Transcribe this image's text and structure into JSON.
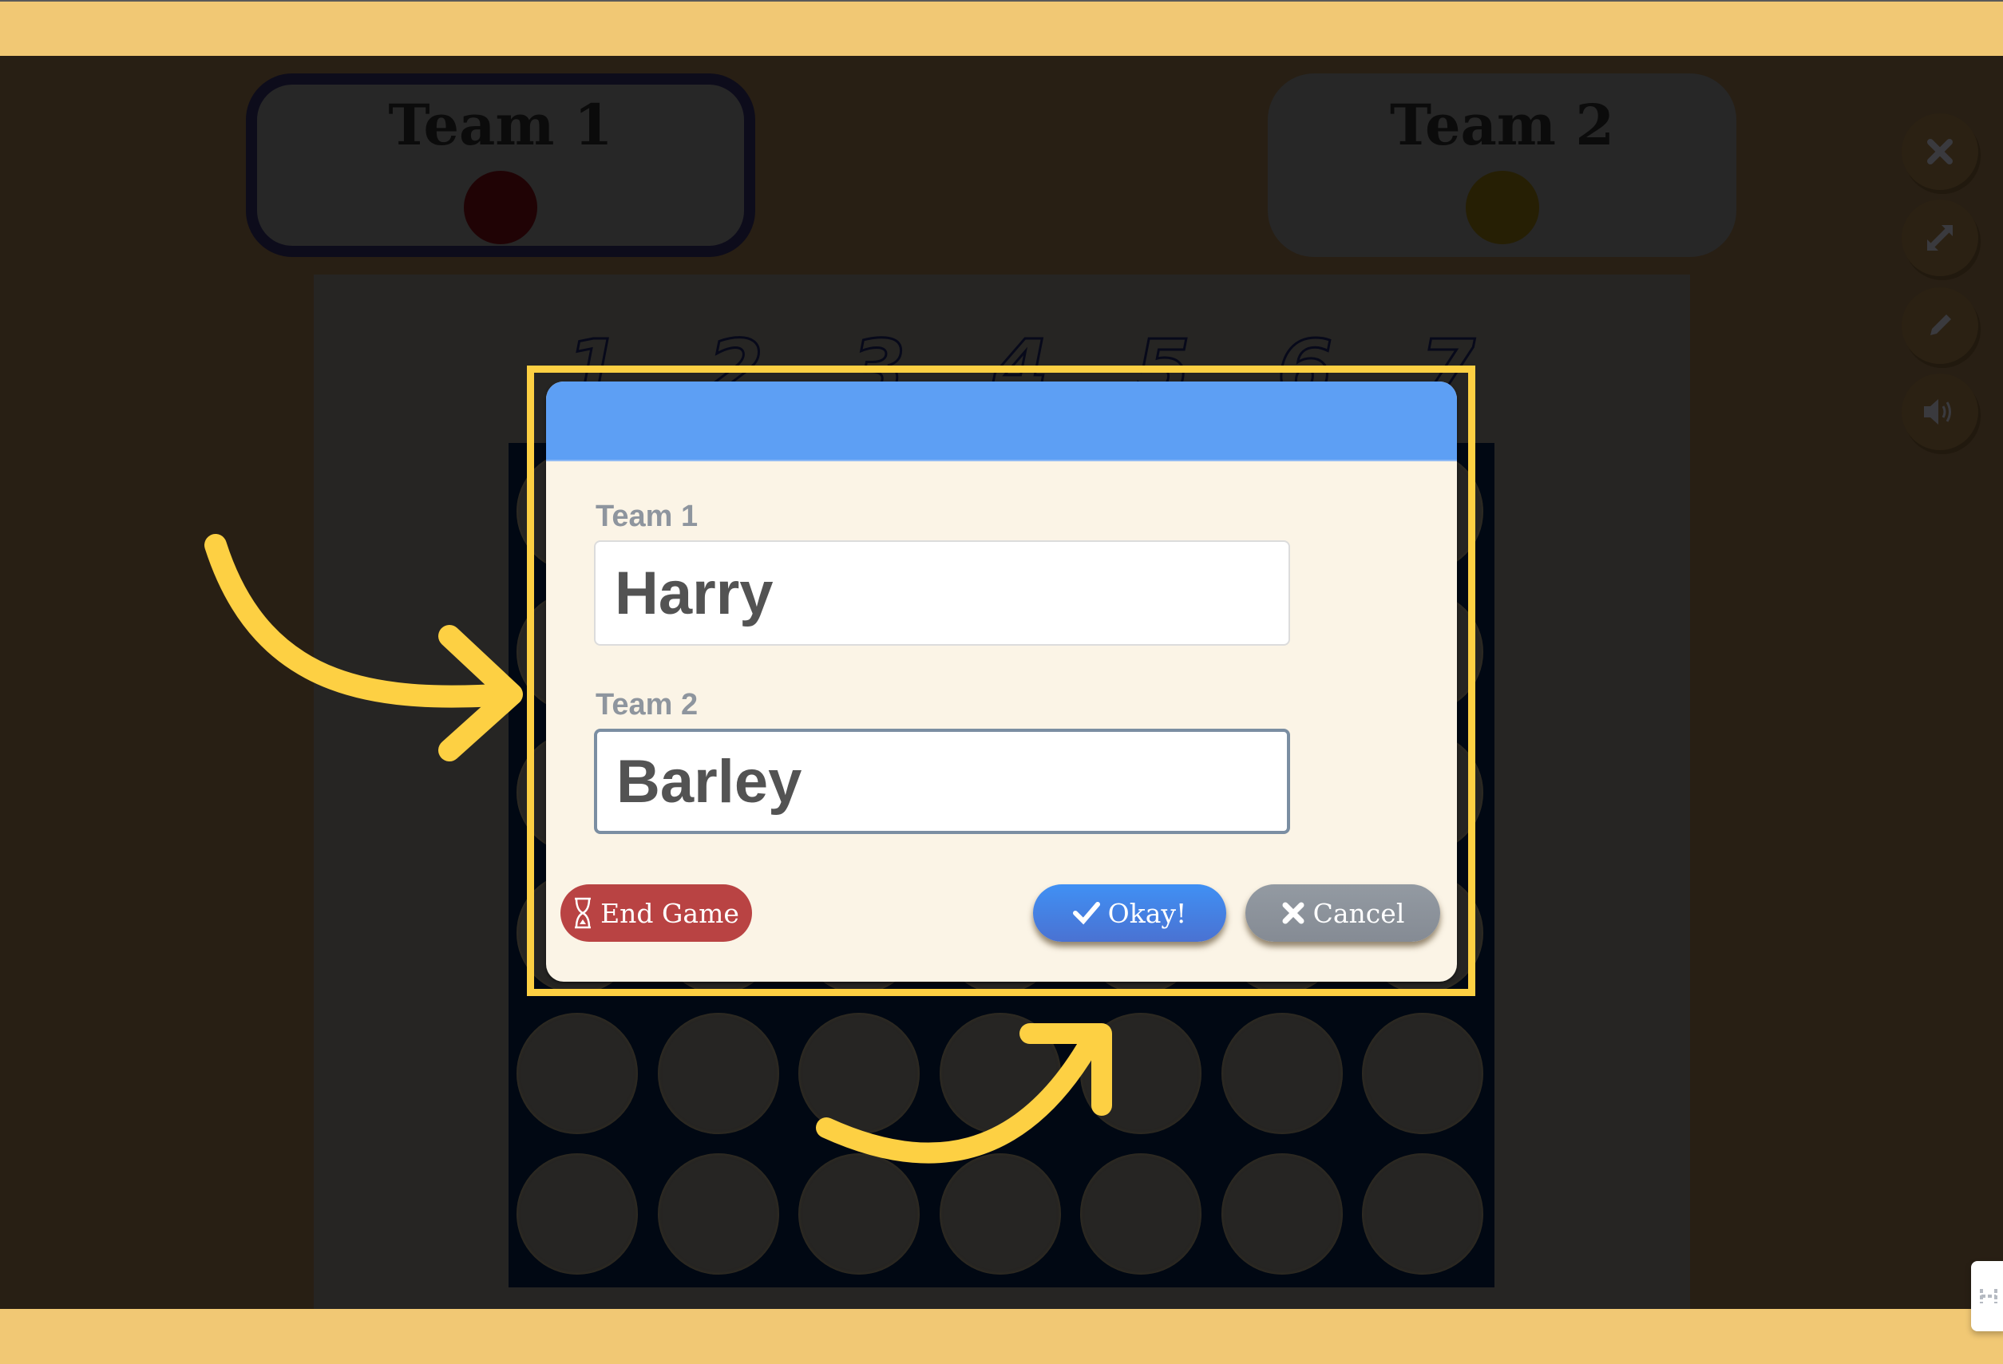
{
  "scoreboard": {
    "teams": [
      {
        "name": "Team 1",
        "chip_color": "#200305",
        "active": true
      },
      {
        "name": "Team 2",
        "chip_color": "#261f04",
        "active": false
      }
    ]
  },
  "board": {
    "column_numbers": [
      "1",
      "2",
      "3",
      "4",
      "5",
      "6",
      "7"
    ],
    "columns": 7,
    "visible_rows": 6
  },
  "side_controls": [
    {
      "icon": "close-icon",
      "glyph": "✕"
    },
    {
      "icon": "fullscreen-icon",
      "glyph": "⤢"
    },
    {
      "icon": "pencil-icon",
      "glyph": "✎"
    },
    {
      "icon": "volume-icon",
      "glyph": "🔊"
    }
  ],
  "dialog": {
    "fields": [
      {
        "label": "Team 1",
        "value": "Harry",
        "focused": false
      },
      {
        "label": "Team 2",
        "value": "Barley",
        "focused": true
      }
    ],
    "buttons": {
      "end_game": {
        "label": "End Game",
        "icon": "hourglass-icon",
        "color": "#b94343"
      },
      "okay": {
        "label": "Okay!",
        "icon": "check-icon",
        "color": "#4a80e4"
      },
      "cancel": {
        "label": "Cancel",
        "icon": "x-icon",
        "color": "#8c929a"
      }
    },
    "header_color": "#5d9ff4"
  },
  "annotations": {
    "highlight_color": "#fdd043"
  }
}
